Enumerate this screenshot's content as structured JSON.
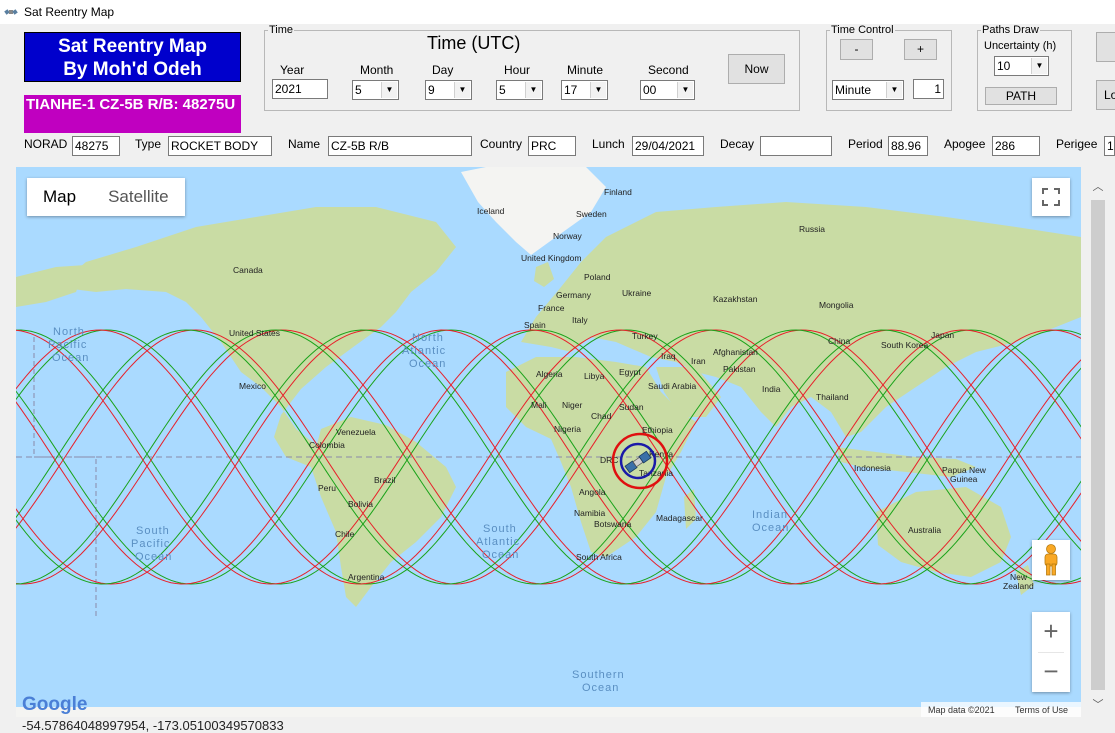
{
  "window": {
    "title": "Sat Reentry Map"
  },
  "banner": {
    "line1": "Sat Reentry Map",
    "line2": "By Moh'd Odeh",
    "satellite_title": "TIANHE-1 CZ-5B R/B: 48275U"
  },
  "time_group": {
    "legend": "Time",
    "heading": "Time (UTC)",
    "year_label": "Year",
    "year": "2021",
    "month_label": "Month",
    "month": "5",
    "day_label": "Day",
    "day": "9",
    "hour_label": "Hour",
    "hour": "5",
    "minute_label": "Minute",
    "minute": "17",
    "second_label": "Second",
    "second": "00",
    "now_label": "Now"
  },
  "time_control": {
    "legend": "Time Control",
    "minus": "-",
    "plus": "+",
    "unit": "Minute",
    "step": "1"
  },
  "paths_draw": {
    "legend": "Paths Draw",
    "uncertainty_label": "Uncertainty (h)",
    "uncertainty": "10",
    "path_label": "PATH"
  },
  "right_buttons": {
    "lower_partial": "Lo"
  },
  "info": {
    "norad_label": "NORAD",
    "norad": "48275",
    "type_label": "Type",
    "type": "ROCKET BODY",
    "name_label": "Name",
    "name": "CZ-5B R/B",
    "country_label": "Country",
    "country": "PRC",
    "lunch_label": "Lunch",
    "lunch": "29/04/2021",
    "decay_label": "Decay",
    "decay": "",
    "period_label": "Period",
    "period": "88.96",
    "apogee_label": "Apogee",
    "apogee": "286",
    "perigee_label": "Perigee",
    "perigee": "1"
  },
  "map": {
    "type_map": "Map",
    "type_satellite": "Satellite",
    "zoom_in": "+",
    "zoom_out": "−",
    "attribution": "Map data ©2021",
    "terms": "Terms of Use",
    "google": "Google",
    "countries": {
      "finland": "Finland",
      "sweden": "Sweden",
      "norway": "Norway",
      "iceland": "Iceland",
      "russia": "Russia",
      "uk": "United Kingdom",
      "poland": "Poland",
      "germany": "Germany",
      "ukraine": "Ukraine",
      "france": "France",
      "kazakhstan": "Kazakhstan",
      "mongolia": "Mongolia",
      "spain": "Spain",
      "italy": "Italy",
      "turkey": "Turkey",
      "china": "China",
      "south_korea": "South Korea",
      "japan": "Japan",
      "iraq": "Iraq",
      "iran": "Iran",
      "afghanistan": "Afghanistan",
      "pakistan": "Pakistan",
      "algeria": "Algeria",
      "libya": "Libya",
      "egypt": "Egypt",
      "saudi": "Saudi Arabia",
      "india": "India",
      "thailand": "Thailand",
      "mali": "Mali",
      "niger": "Niger",
      "chad": "Chad",
      "sudan": "Sudan",
      "nigeria": "Nigeria",
      "ethiopia": "Ethiopia",
      "drc": "DRC",
      "kenya": "Kenya",
      "tanzania": "Tanzania",
      "angola": "Angola",
      "namibia": "Namibia",
      "botswana": "Botswana",
      "madagascar": "Madagascar",
      "south_africa": "South Africa",
      "canada": "Canada",
      "us": "United States",
      "mexico": "Mexico",
      "venezuela": "Venezuela",
      "colombia": "Colombia",
      "peru": "Peru",
      "brazil": "Brazil",
      "bolivia": "Bolivia",
      "chile": "Chile",
      "argentina": "Argentina",
      "indonesia": "Indonesia",
      "papua": "Papua New",
      "guinea": "Guinea",
      "australia": "Australia",
      "new_zealand_1": "New",
      "new_zealand_2": "Zealand"
    },
    "oceans": {
      "np1": "North",
      "np2": "Pacific",
      "np3": "Ocean",
      "na1": "North",
      "na2": "Atlantic",
      "na3": "Ocean",
      "sp1": "South",
      "sp2": "Pacific",
      "sp3": "Ocean",
      "sa1": "South",
      "sa2": "Atlantic",
      "sa3": "Ocean",
      "io1": "Indian",
      "io2": "Ocean",
      "so1": "Southern",
      "so2": "Ocean"
    }
  },
  "status": {
    "coordinates": "-54.57864048997954, -173.05100349570833"
  },
  "colors": {
    "track_green": "#1aa31a",
    "track_red": "#e8202a",
    "land": "#c9dca4",
    "ocean": "#aadaff"
  }
}
